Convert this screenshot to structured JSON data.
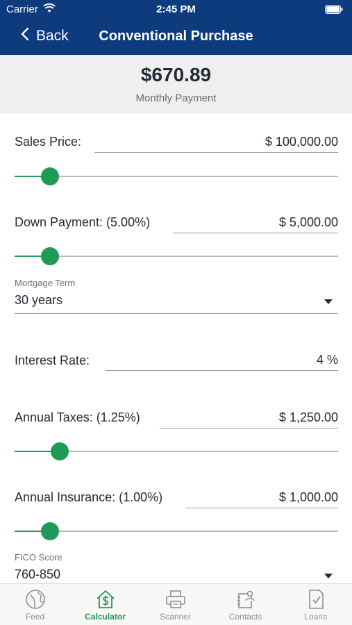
{
  "status_bar": {
    "carrier": "Carrier",
    "time": "2:45 PM"
  },
  "nav": {
    "back_label": "Back",
    "title": "Conventional Purchase"
  },
  "summary": {
    "amount": "$670.89",
    "label": "Monthly Payment"
  },
  "fields": {
    "sales_price": {
      "label": "Sales Price:",
      "value": "$ 100,000.00",
      "slider_fraction": 0.11
    },
    "down_payment": {
      "label": "Down Payment: (5.00%)",
      "value": "$ 5,000.00",
      "slider_fraction": 0.11
    },
    "mortgage_term": {
      "label": "Mortgage Term",
      "value": "30 years"
    },
    "interest_rate": {
      "label": "Interest Rate:",
      "value": "4 %"
    },
    "annual_taxes": {
      "label": "Annual Taxes: (1.25%)",
      "value": "$ 1,250.00",
      "slider_fraction": 0.14
    },
    "annual_insurance": {
      "label": "Annual Insurance: (1.00%)",
      "value": "$ 1,000.00",
      "slider_fraction": 0.11
    },
    "fico_score": {
      "label": "FICO Score",
      "value": "760-850"
    }
  },
  "tabs": [
    {
      "label": "Feed",
      "icon": "globe-icon",
      "active": false
    },
    {
      "label": "Calculator",
      "icon": "calculator-house-icon",
      "active": true
    },
    {
      "label": "Scanner",
      "icon": "printer-icon",
      "active": false
    },
    {
      "label": "Contacts",
      "icon": "contacts-icon",
      "active": false
    },
    {
      "label": "Loans",
      "icon": "document-check-icon",
      "active": false
    }
  ],
  "colors": {
    "header": "#0e3b7d",
    "accent": "#1e9a56",
    "summary_bg": "#efefef"
  }
}
